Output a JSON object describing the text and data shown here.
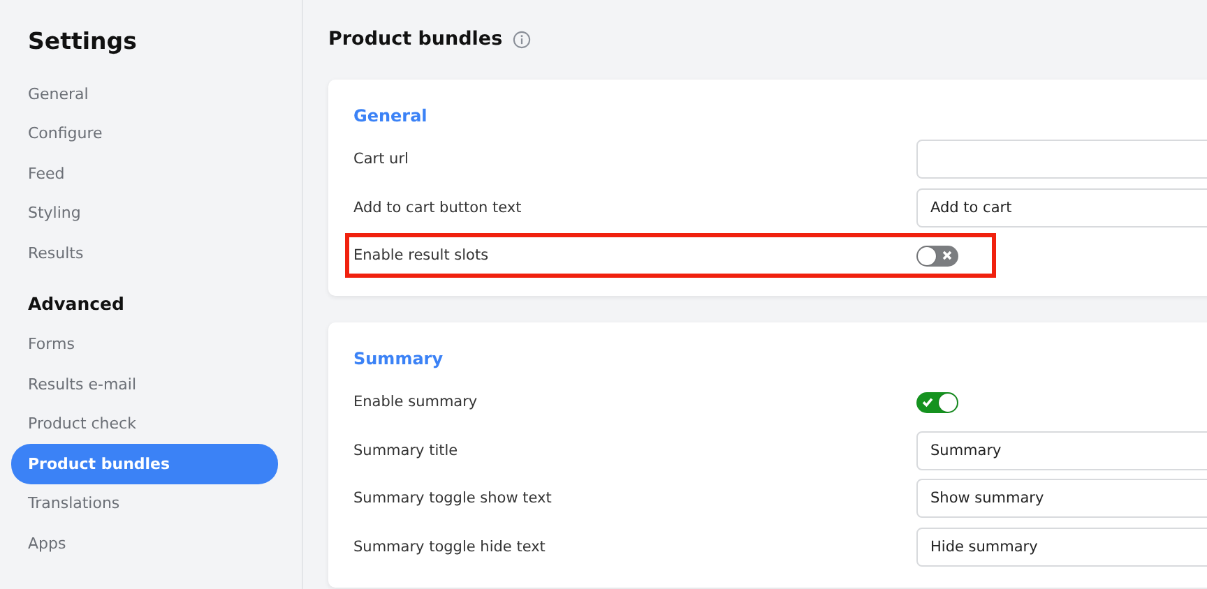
{
  "sidebar": {
    "title": "Settings",
    "groups": [
      {
        "items": [
          {
            "label": "General",
            "selected": false
          },
          {
            "label": "Configure",
            "selected": false
          },
          {
            "label": "Feed",
            "selected": false
          },
          {
            "label": "Styling",
            "selected": false
          },
          {
            "label": "Results",
            "selected": false
          }
        ]
      },
      {
        "heading": "Advanced",
        "items": [
          {
            "label": "Forms",
            "selected": false
          },
          {
            "label": "Results e-mail",
            "selected": false
          },
          {
            "label": "Product check",
            "selected": false
          },
          {
            "label": "Product bundles",
            "selected": true
          },
          {
            "label": "Translations",
            "selected": false
          },
          {
            "label": "Apps",
            "selected": false
          }
        ]
      }
    ]
  },
  "page": {
    "title": "Product bundles"
  },
  "sections": [
    {
      "title": "General",
      "settings": [
        {
          "kind": "input",
          "label": "Cart url",
          "highlighted": false
        },
        {
          "kind": "input",
          "label": "Add to cart button text",
          "value": "Add to cart",
          "highlighted": false
        },
        {
          "kind": "toggle",
          "label": "Enable result slots",
          "on": false,
          "highlighted": true
        }
      ]
    },
    {
      "title": "Summary",
      "settings": [
        {
          "kind": "toggle",
          "label": "Enable summary",
          "on": true,
          "highlighted": false
        },
        {
          "kind": "input",
          "label": "Summary title",
          "value": "Summary",
          "highlighted": false
        },
        {
          "kind": "input",
          "label": "Summary toggle show text",
          "value": "Show summary",
          "highlighted": false
        },
        {
          "kind": "input",
          "label": "Summary toggle hide text",
          "value": "Hide summary",
          "highlighted": false
        }
      ]
    }
  ]
}
